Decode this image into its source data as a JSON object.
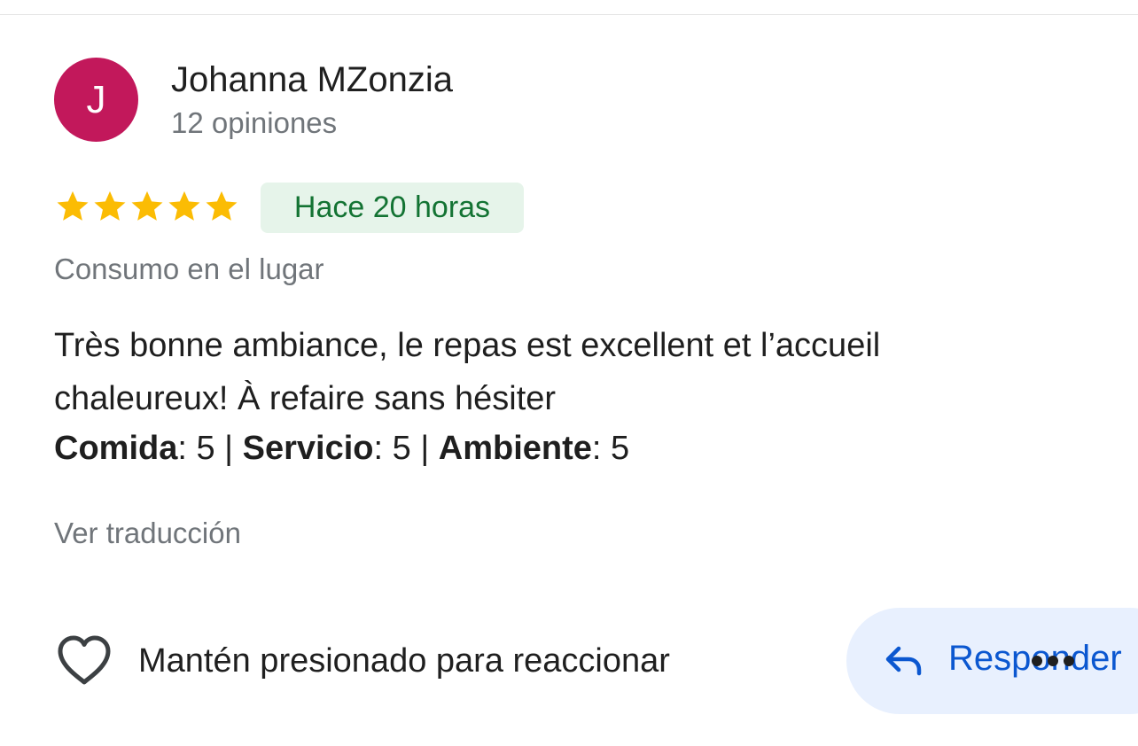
{
  "author": {
    "initial": "J",
    "name": "Johanna MZonzia",
    "review_count": "12 opiniones",
    "avatar_color": "#c2185b"
  },
  "review": {
    "rating": 5,
    "rating_max": 5,
    "star_color": "#fbbc04",
    "time_ago": "Hace 20 horas",
    "dining_mode": "Consumo en el lugar",
    "text_line1": "Très bonne ambiance, le repas est excellent et l’accueil",
    "text_line2": "chaleureux! À refaire sans hésiter",
    "ratings": [
      {
        "label": "Comida",
        "value": "5"
      },
      {
        "label": "Servicio",
        "value": "5"
      },
      {
        "label": "Ambiente",
        "value": "5"
      }
    ],
    "translate_label": "Ver traducción"
  },
  "actions": {
    "react_label": "Mantén presionado para reaccionar",
    "reply_label": "Responder",
    "accent_color": "#0b57d0"
  },
  "icons": {
    "reaction": "heart-icon",
    "reply": "reply-arrow-icon",
    "more": "more-horizontal-icon"
  }
}
